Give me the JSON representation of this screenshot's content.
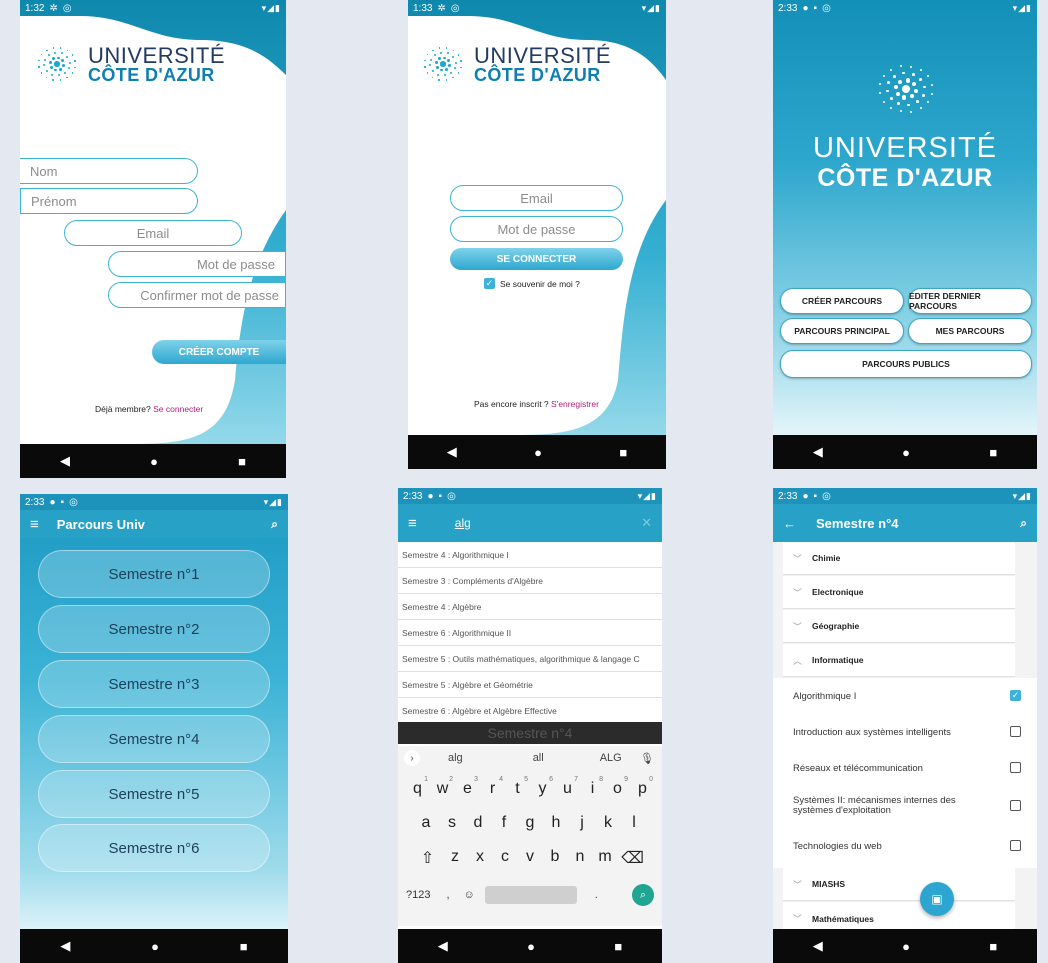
{
  "colors": {
    "accent": "#27a2c6",
    "brand_dark": "#233a62",
    "brand_blue": "#0f7fb1",
    "link": "#b0207a"
  },
  "status": {
    "p1": "1:32",
    "p2": "1:33",
    "p3": "2:33",
    "p4": "2:33",
    "p5": "2:33",
    "p6": "2:33"
  },
  "nav": {
    "back": "◀",
    "home": "●",
    "recent": "■"
  },
  "logo": {
    "line1": "UNIVERSITÉ",
    "line2": "CÔTE D'AZUR"
  },
  "register": {
    "nom_placeholder": "Nom",
    "prenom_placeholder": "Prénom",
    "email_placeholder": "Email",
    "password_placeholder": "Mot de passe",
    "confirm_placeholder": "Confirmer mot de passe",
    "create_button": "CRÉER COMPTE",
    "member_text": "Déjà membre?",
    "login_link": "Se connecter"
  },
  "login": {
    "email_placeholder": "Email",
    "password_placeholder": "Mot de passe",
    "connect_button": "SE CONNECTER",
    "remember_label": "Se souvenir de moi ?",
    "not_registered": "Pas encore inscrit ?",
    "register_link": "S'enregistrer"
  },
  "home": {
    "create": "CRÉER PARCOURS",
    "edit_last": "EDITER DERNIER PARCOURS",
    "main": "PARCOURS PRINCIPAL",
    "mine": "MES PARCOURS",
    "public": "PARCOURS PUBLICS"
  },
  "semesters": {
    "title": "Parcours Univ",
    "items": [
      "Semestre n°1",
      "Semestre n°2",
      "Semestre n°3",
      "Semestre n°4",
      "Semestre n°5",
      "Semestre n°6"
    ]
  },
  "search": {
    "query": "alg",
    "results": [
      "Semestre 4 : Algorithmique I",
      "Semestre 3 : Compléments d'Algèbre",
      "Semestre 4 : Algèbre",
      "Semestre 6 : Algorithmique II",
      "Semestre 5 : Outils mathématiques, algorithmique & langage C",
      "Semestre 5 : Algèbre et Géométrie",
      "Semestre 6 : Algèbre et Algèbre Effective"
    ],
    "behind": "Semestre n°4",
    "suggestions": [
      "alg",
      "all",
      "ALG"
    ],
    "row1": [
      "q",
      "w",
      "e",
      "r",
      "t",
      "y",
      "u",
      "i",
      "o",
      "p"
    ],
    "row1_nums": [
      "1",
      "2",
      "3",
      "4",
      "5",
      "6",
      "7",
      "8",
      "9",
      "0"
    ],
    "row2": [
      "a",
      "s",
      "d",
      "f",
      "g",
      "h",
      "j",
      "k",
      "l"
    ],
    "row3": [
      "z",
      "x",
      "c",
      "v",
      "b",
      "n",
      "m"
    ],
    "sym": "?123",
    "comma": ",",
    "period": "."
  },
  "detail": {
    "title": "Semestre n°4",
    "cats_top": [
      "Chimie",
      "Electronique",
      "Géographie",
      "Informatique"
    ],
    "courses": [
      {
        "name": "Algorithmique I",
        "checked": true
      },
      {
        "name": "Introduction aux systèmes intelligents",
        "checked": false
      },
      {
        "name": "Réseaux et télécommunication",
        "checked": false
      },
      {
        "name": "Systèmes II: mécanismes internes des systèmes d'exploitation",
        "checked": false
      },
      {
        "name": "Technologies du web",
        "checked": false
      }
    ],
    "cats_bottom": [
      "MIASHS",
      "Mathématiques"
    ]
  }
}
